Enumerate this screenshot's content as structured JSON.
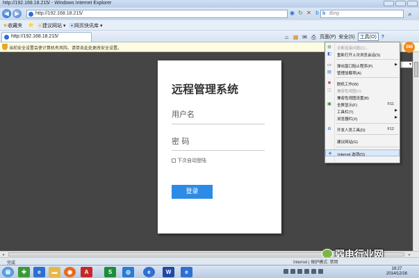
{
  "window": {
    "title": "http://192.168.18.215/ - Windows Internet Explorer"
  },
  "address_bar": {
    "url": "http://192.168.18.215/",
    "search_placeholder": "Bing"
  },
  "favorites_bar": {
    "favorites": "收藏夹",
    "items": [
      "建议网站",
      "网页快讯库"
    ]
  },
  "tab": {
    "label": "http://192.168.18.215/"
  },
  "command_bar": {
    "page": "页面(P)",
    "safety": "安全(S)",
    "tools": "工具(O)",
    "help": "?"
  },
  "info_bar": {
    "text": "当前安全设置会使计算机有风险。请单击此处更改安全设置。"
  },
  "login": {
    "title": "远程管理系统",
    "username_label": "用户名",
    "password_label": "密  码",
    "remember_label": "下次自动登陆",
    "login_button": "登录"
  },
  "tools_menu": [
    {
      "label": "诊断连接问题(C)...",
      "disabled": true,
      "icon": "diagnose-icon"
    },
    {
      "label": "重新打开上次浏览会话(S)",
      "icon": "reopen-icon"
    },
    {
      "label": "弹出窗口阻止程序(P)",
      "submenu": true,
      "icon": "popup-icon"
    },
    {
      "label": "管理加载项(A)",
      "icon": "addons-icon"
    },
    {
      "label": "脱机工作(W)",
      "icon": "offline-icon"
    },
    {
      "label": "兼容性视图(V)",
      "disabled": true,
      "icon": "compat-icon"
    },
    {
      "label": "兼容性视图设置(B)",
      "icon": "compat-settings-icon"
    },
    {
      "label": "全屏显示(F)",
      "shortcut": "F11",
      "icon": "fullscreen-icon"
    },
    {
      "label": "工具栏(T)",
      "submenu": true,
      "icon": "toolbar-icon"
    },
    {
      "label": "浏览器栏(X)",
      "submenu": true,
      "icon": "explorer-bar-icon"
    },
    {
      "label": "开发人员工具(D)",
      "shortcut": "F12",
      "icon": "devtools-icon"
    },
    {
      "label": "建议网站(G)",
      "icon": "suggested-sites-icon"
    },
    {
      "label": "Internet 选项(O)",
      "highlighted": true,
      "icon": "internet-options-icon"
    }
  ],
  "status_bar": {
    "status": "完成",
    "zone": "Internet | 保护模式: 禁用"
  },
  "taskbar": {
    "time": "18:27",
    "date": "2014/12/16"
  },
  "watermark": {
    "text": "弱电行业网"
  }
}
